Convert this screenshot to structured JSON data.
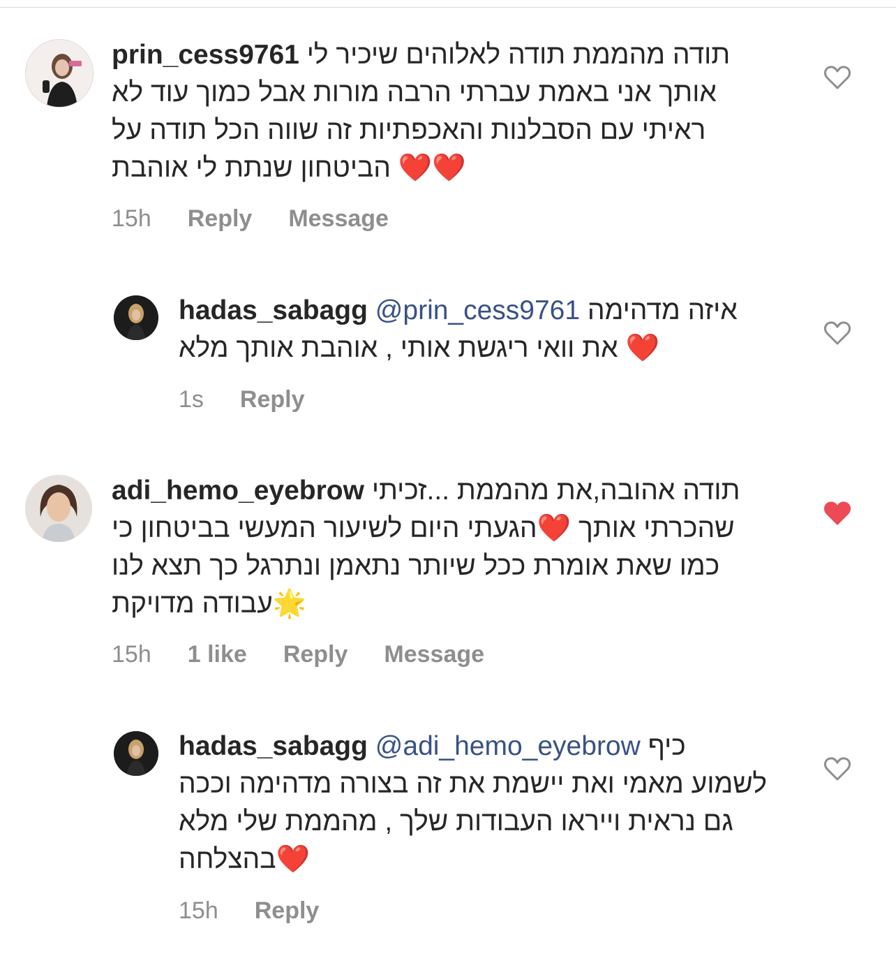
{
  "comments": [
    {
      "username": "prin_cess9761",
      "lines": [
        "תודה מהממת  תודה לאלוהים שיכיר לי",
        "אותך  אני באמת עברתי הרבה מורות אבל כמוך עוד לא",
        "ראיתי עם הסבלנות והאכפתיות זה שווה הכל תודה על",
        "הביטחון שנתת לי אוהבת"
      ],
      "line4_emoji": "❤️❤️",
      "time": "15h",
      "reply": "Reply",
      "message": "Message",
      "liked": false
    },
    {
      "username": "hadas_sabagg",
      "mention": "@prin_cess9761",
      "line1": "איזה מדהימה",
      "line2": "את וואי ריגשת אותי , אוהבת אותך מלא",
      "line2_emoji": "❤️",
      "time": "1s",
      "reply": "Reply",
      "liked": false
    },
    {
      "username": "adi_hemo_eyebrow",
      "lines": [
        "תודה אהובה,את מהממת ...זכיתי",
        "שהכרתי אותך",
        "הגעתי היום לשיעור המעשי בביטחון כי",
        "כמו שאת אומרת ככל שיותר נתאמן ונתרגל כך תצא לנו",
        "עבודה מדויקת"
      ],
      "line2_emoji": "❤️",
      "line4_emoji": "🌟",
      "time": "15h",
      "likes": "1 like",
      "reply": "Reply",
      "message": "Message",
      "liked": true
    },
    {
      "username": "hadas_sabagg",
      "mention": "@adi_hemo_eyebrow",
      "lines": [
        "כיף",
        "לשמוע מאמי ואת יישמת את זה בצורה מדהימה וככה",
        "גם נראית וייראו העבודות שלך , מהממת שלי מלא",
        "בהצלחה"
      ],
      "line4_emoji": "❤️",
      "time": "15h",
      "reply": "Reply",
      "liked": false
    }
  ],
  "colors": {
    "text": "#262626",
    "meta": "#8e8e8e",
    "mention": "#385185",
    "liked_heart": "#ed4956"
  },
  "icons": {
    "like_outline": "heart-outline-icon",
    "like_filled": "heart-filled-icon"
  }
}
